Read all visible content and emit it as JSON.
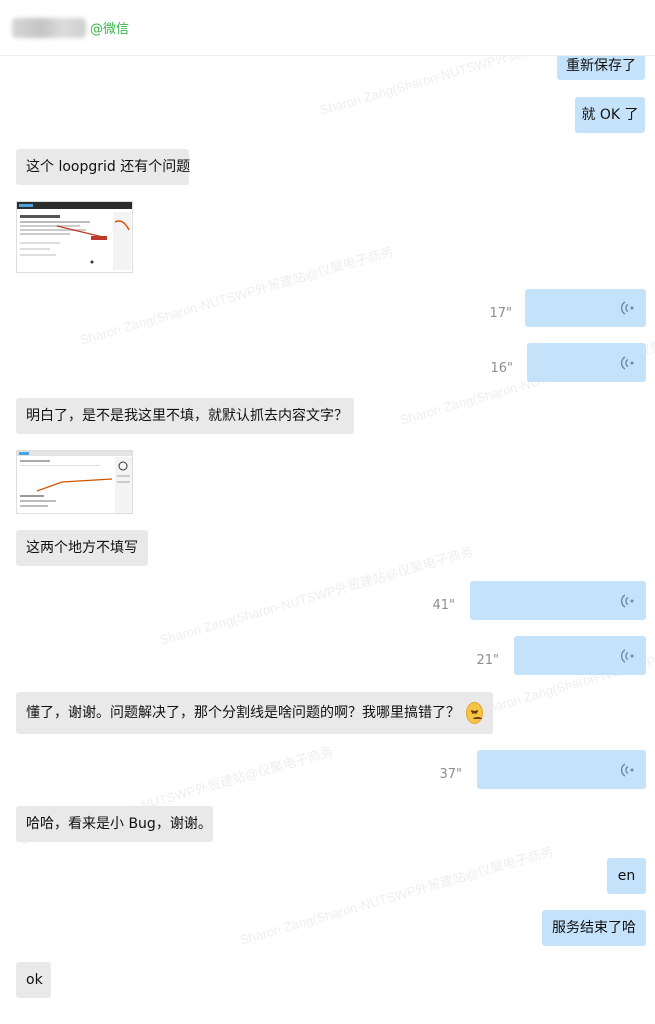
{
  "header": {
    "contact_suffix": "@微信"
  },
  "watermark": "Sharon Zang(Sharon-NUTSWP外贸建站@仪聚电子商务",
  "messages": {
    "m1": "重新保存了",
    "m2": "就 OK 了",
    "m3": "这个 loopgrid 还有个问题",
    "m4": "明白了，是不是我这里不填，就默认抓去内容文字？",
    "m5": "这两个地方不填写",
    "m6": "懂了，谢谢。问题解决了，那个分割线是啥问题的啊？我哪里搞错了？",
    "m7": "哈哈，看来是小 Bug，谢谢。",
    "m8": "en",
    "m9": "服务结束了哈",
    "m10": "ok"
  },
  "voice": {
    "v1": "17\"",
    "v2": "16\"",
    "v3": "41\"",
    "v4": "21\"",
    "v5": "37\""
  },
  "icons": {
    "voice": "voice-wave-icon",
    "emoji": "frowning-face-emoji"
  },
  "colors": {
    "outgoing": "#c5e2fb",
    "incoming": "#e9e9e9",
    "wechat_green": "#3ab34a"
  }
}
